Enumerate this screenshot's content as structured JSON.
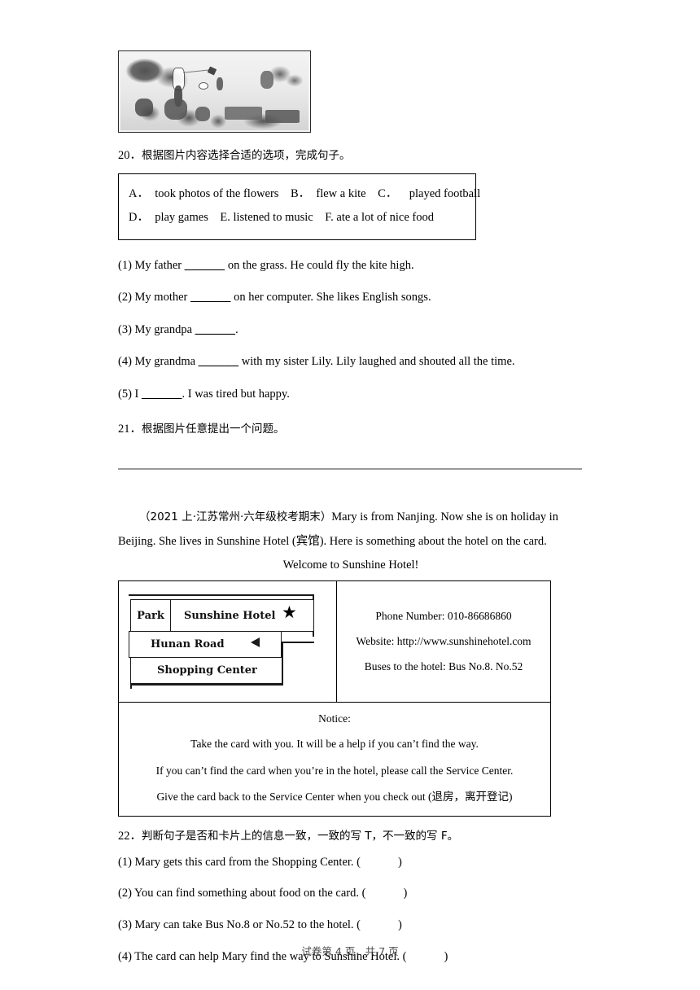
{
  "illustration": {
    "alt": "family picnic scene with kite flying, football and food baskets"
  },
  "question20": {
    "number": "20．",
    "stem": "根据图片内容选择合适的选项，完成句子。",
    "options_line1": "A．  took photos of the flowers    B．  flew a kite    C．    played football",
    "options_line2": "D．  play games    E. listened to music    F. ate a lot of nice food",
    "items": [
      {
        "label": "(1) My father",
        "blank": "______",
        "tail": "on the grass. He could fly the kite high."
      },
      {
        "label": "(2) My mother",
        "blank": "______",
        "tail": "on her computer. She likes English songs."
      },
      {
        "label": "(3) My grandpa",
        "blank": "______",
        "tail": "."
      },
      {
        "label": "(4) My grandma",
        "blank": "______",
        "tail": "with my sister Lily. Lily laughed and shouted all the time."
      },
      {
        "label": "(5) I",
        "blank": "______",
        "tail": ". I was tired but happy."
      }
    ]
  },
  "question21": {
    "number": "21．",
    "stem": "根据图片任意提出一个问题。"
  },
  "passage": {
    "source": "（2021 上·江苏常州·六年级校考期末）",
    "line1": "Mary is from Nanjing. Now she is on holiday in",
    "line2": "Beijing. She lives in Sunshine Hotel (宾馆). Here is something about the hotel on the card.",
    "title": "Welcome to Sunshine Hotel!"
  },
  "card": {
    "map": {
      "park": "Park",
      "hotel": "Sunshine Hotel",
      "star": "★",
      "road": "Hunan Road",
      "shopping_center": "Shopping  Center"
    },
    "info": {
      "phone": "Phone Number: 010-86686860",
      "website": "Website: http://www.sunshinehotel.com",
      "buses": "Buses to the hotel: Bus No.8. No.52"
    },
    "notice": {
      "title": "Notice:",
      "line1": "Take the card with you. It will be a help if you can’t find the way.",
      "line2": "If you can’t find the card when you’re in the hotel, please call the Service Center.",
      "line3": "Give the card back to the Service Center when you check out (退房，离开登记)"
    }
  },
  "question22": {
    "number": "22．",
    "stem": "判断句子是否和卡片上的信息一致，一致的写 T，不一致的写 F。",
    "items": [
      {
        "text": "(1) Mary gets this card from the Shopping Center. (",
        "close": ")"
      },
      {
        "text": "(2) You can find something about food on the card. (",
        "close": ")"
      },
      {
        "text": "(3) Mary can take Bus No.8 or No.52 to the hotel. (",
        "close": ")"
      },
      {
        "text": "(4) The card can help Mary find the way to Sunshine Hotel. (",
        "close": ")"
      }
    ]
  },
  "footer": {
    "text": "试卷第 4 页，共 7 页"
  }
}
